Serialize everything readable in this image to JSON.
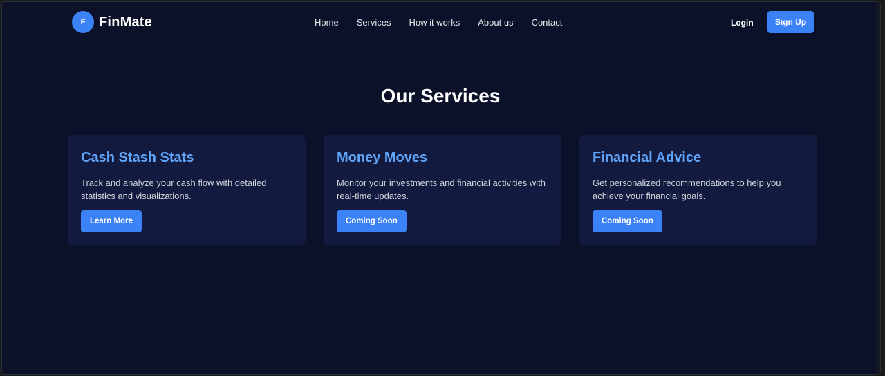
{
  "brand": {
    "logo_letter": "F",
    "name": "FinMate"
  },
  "nav": {
    "items": [
      "Home",
      "Services",
      "How it works",
      "About us",
      "Contact"
    ],
    "login": "Login",
    "signup": "Sign Up"
  },
  "section": {
    "title": "Our Services"
  },
  "cards": [
    {
      "title": "Cash Stash Stats",
      "text": "Track and analyze your cash flow with detailed statistics and visualizations.",
      "button": "Learn More"
    },
    {
      "title": "Money Moves",
      "text": "Monitor your investments and financial activities with real-time updates.",
      "button": "Coming Soon"
    },
    {
      "title": "Financial Advice",
      "text": "Get personalized recommendations to help you achieve your financial goals.",
      "button": "Coming Soon"
    }
  ],
  "colors": {
    "background": "#0b1128",
    "card": "#121b3f",
    "accent": "#3b82f6",
    "card_title": "#60a5fa"
  }
}
